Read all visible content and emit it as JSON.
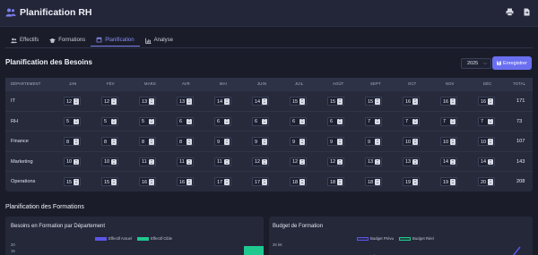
{
  "app": {
    "title": "Planification RH"
  },
  "tabs": [
    {
      "label": "Effectifs",
      "icon": "users-icon"
    },
    {
      "label": "Formations",
      "icon": "graduation-cap-icon"
    },
    {
      "label": "Planification",
      "icon": "calendar-icon",
      "active": true
    },
    {
      "label": "Analyse",
      "icon": "bar-chart-icon"
    }
  ],
  "section": {
    "title": "Planification des Besoins",
    "year": "2025",
    "save_label": "Enregistrer"
  },
  "table": {
    "headers": [
      "DÉPARTEMENT",
      "JAN",
      "FÉV",
      "MARS",
      "AVR",
      "MAI",
      "JUIN",
      "JUIL",
      "AOÛT",
      "SEPT",
      "OCT",
      "NOV",
      "DÉC",
      "TOTAL"
    ],
    "rows": [
      {
        "dept": "IT",
        "values": [
          12,
          12,
          13,
          13,
          14,
          14,
          15,
          15,
          15,
          16,
          16,
          16
        ],
        "total": "171"
      },
      {
        "dept": "RH",
        "values": [
          5,
          5,
          5,
          6,
          6,
          6,
          6,
          6,
          7,
          7,
          7,
          7
        ],
        "total": "73"
      },
      {
        "dept": "Finance",
        "values": [
          8,
          8,
          8,
          8,
          9,
          9,
          9,
          9,
          9,
          10,
          10,
          10
        ],
        "total": "107"
      },
      {
        "dept": "Marketing",
        "values": [
          10,
          10,
          11,
          11,
          11,
          12,
          12,
          12,
          13,
          13,
          14,
          14
        ],
        "total": "143"
      },
      {
        "dept": "Operations",
        "values": [
          15,
          15,
          16,
          16,
          17,
          17,
          18,
          18,
          18,
          19,
          19,
          20
        ],
        "total": "208"
      }
    ]
  },
  "formations": {
    "title": "Planification des Formations",
    "chart1": {
      "title": "Besoins en Formation par Département",
      "legend": [
        "Effectif Actuel",
        "Effectif Cible"
      ],
      "colors": [
        "#5b55e8",
        "#1fc88f"
      ],
      "yticks": [
        "20",
        "15"
      ]
    },
    "chart2": {
      "title": "Budget de Formation",
      "legend": [
        "Budget Prévu",
        "Budget Réel"
      ],
      "colors": [
        "#5b55e8",
        "#1fc88f"
      ],
      "yticks": [
        "25 k€"
      ]
    }
  }
}
